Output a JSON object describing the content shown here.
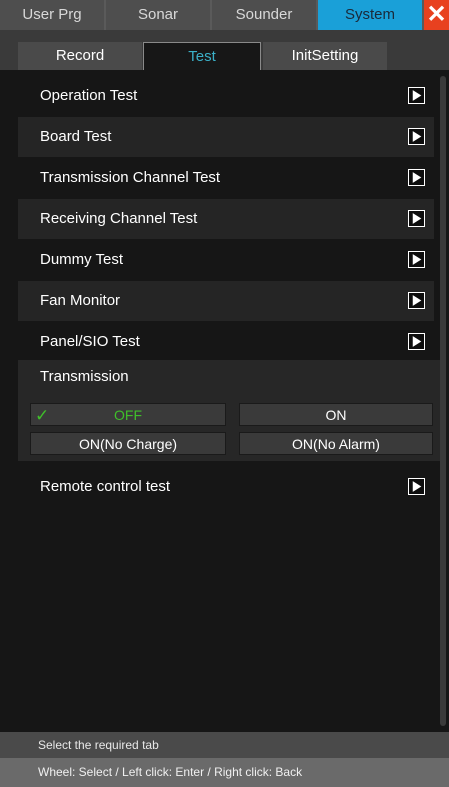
{
  "main_tabs": [
    {
      "label": "User Prg"
    },
    {
      "label": "Sonar"
    },
    {
      "label": "Sounder"
    },
    {
      "label": "System"
    }
  ],
  "main_tab_active": "System",
  "close_symbol": "✕",
  "sub_tabs": [
    {
      "label": "Record"
    },
    {
      "label": "Test"
    },
    {
      "label": "InitSetting"
    }
  ],
  "sub_tab_active": "Test",
  "menu_items": [
    {
      "label": "Operation Test"
    },
    {
      "label": "Board Test"
    },
    {
      "label": "Transmission Channel Test"
    },
    {
      "label": "Receiving Channel Test"
    },
    {
      "label": "Dummy Test"
    },
    {
      "label": "Fan Monitor"
    },
    {
      "label": "Panel/SIO Test"
    }
  ],
  "transmission": {
    "title": "Transmission",
    "options": [
      {
        "label": "OFF"
      },
      {
        "label": "ON"
      },
      {
        "label": "ON(No Charge)"
      },
      {
        "label": "ON(No Alarm)"
      }
    ],
    "selected": "OFF",
    "check_symbol": "✓"
  },
  "remote": {
    "label": "Remote control test"
  },
  "status": {
    "line1": "Select the required tab",
    "line2": "Wheel: Select / Left click: Enter / Right click: Back"
  },
  "colors": {
    "accent": "#1aa0d8",
    "close": "#e8411f",
    "selected_text": "#3fbf2a",
    "active_subtab_text": "#3bb0c8"
  },
  "icons": {
    "play": "play-icon",
    "check": "check-icon",
    "close": "close-icon"
  }
}
